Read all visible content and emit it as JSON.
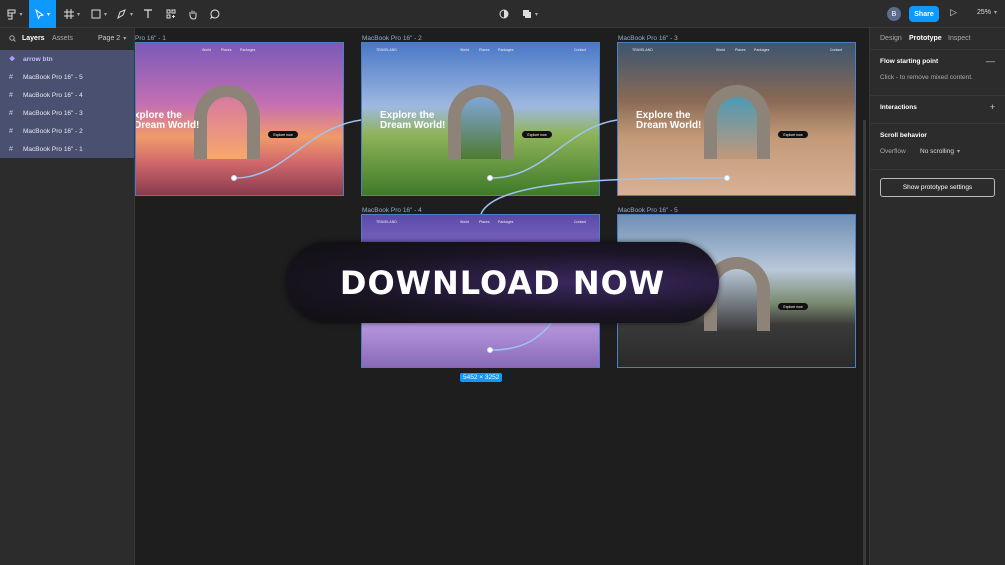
{
  "toolbar": {
    "share_label": "Share",
    "avatar_initial": "B",
    "zoom": "25%"
  },
  "left_panel": {
    "tab_layers": "Layers",
    "tab_assets": "Assets",
    "page": "Page 2",
    "layers": [
      {
        "label": "arrow btn",
        "type": "component"
      },
      {
        "label": "MacBook Pro 16\" - 5",
        "type": "frame"
      },
      {
        "label": "MacBook Pro 16\" - 4",
        "type": "frame"
      },
      {
        "label": "MacBook Pro 16\" - 3",
        "type": "frame"
      },
      {
        "label": "MacBook Pro 16\" - 2",
        "type": "frame"
      },
      {
        "label": "MacBook Pro 16\" - 1",
        "type": "frame"
      }
    ]
  },
  "canvas": {
    "frame_labels": [
      "Pro 16\" - 1",
      "MacBook Pro 16\" - 2",
      "MacBook Pro 16\" - 3",
      "MacBook Pro 16\" - 4",
      "MacBook Pro 16\" - 5"
    ],
    "hero_text_1": "xplore the Dream World!",
    "hero_text_2": "Explore the Dream World!",
    "hero_text_3": "Explore the Dream World!",
    "button_text": "Explore now",
    "nav_items": [
      "World",
      "Places",
      "Packages",
      "Contact"
    ],
    "logo_text": "TRAVELAND",
    "dimensions": "5452 × 3252",
    "banner_text": "DOWNLOAD NOW"
  },
  "right_panel": {
    "tab_design": "Design",
    "tab_prototype": "Prototype",
    "tab_inspect": "Inspect",
    "flow_title": "Flow starting point",
    "flow_note": "Click - to remove mixed content.",
    "interactions_title": "Interactions",
    "scroll_title": "Scroll behavior",
    "overflow_label": "Overflow",
    "overflow_value": "No scrolling",
    "proto_button": "Show prototype settings"
  }
}
